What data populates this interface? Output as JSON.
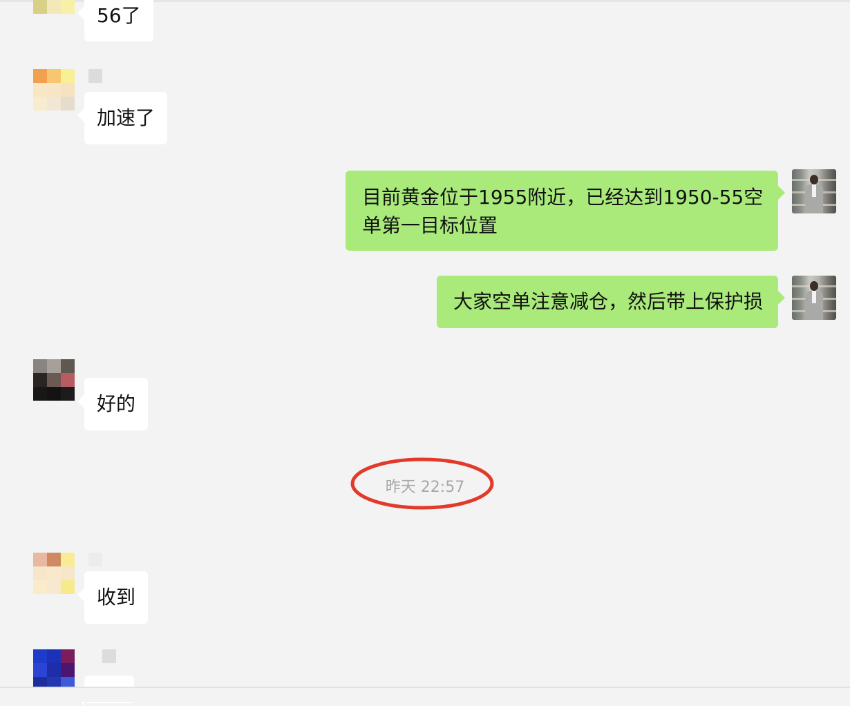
{
  "messages": [
    {
      "id": "m1",
      "direction": "in",
      "text": "56了"
    },
    {
      "id": "m2",
      "direction": "in",
      "text": "加速了"
    },
    {
      "id": "m3",
      "direction": "out",
      "text": "目前黄金位于1955附近，已经达到1950-55空单第一目标位置"
    },
    {
      "id": "m4",
      "direction": "out",
      "text": "大家空单注意减仓，然后带上保护损"
    },
    {
      "id": "m5",
      "direction": "in",
      "text": "好的"
    },
    {
      "id": "m6",
      "direction": "in",
      "text": "收到"
    }
  ],
  "timestamp": {
    "text": "昨天 22:57",
    "annotation_color": "#e23a2a"
  },
  "colors": {
    "background": "#f3f3f3",
    "incoming_bubble": "#ffffff",
    "outgoing_bubble": "#a9ea7a",
    "timestamp_text": "#a8a8a8"
  }
}
